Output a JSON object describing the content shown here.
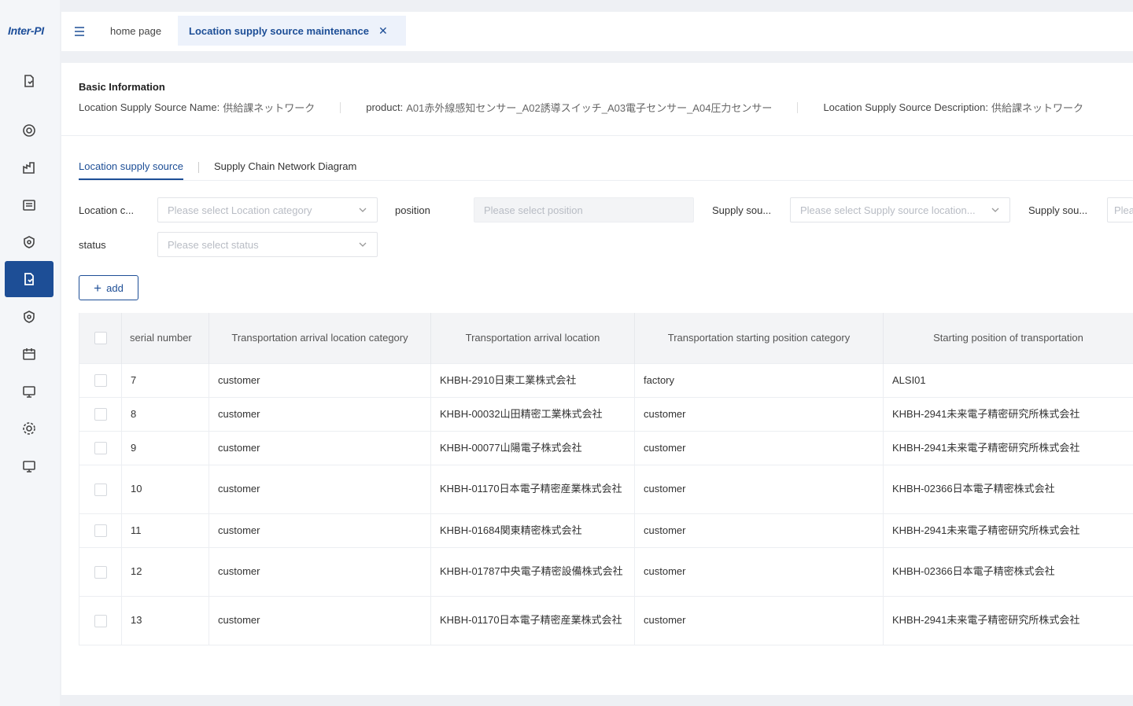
{
  "app": {
    "logo": "Inter-PI"
  },
  "sidebar": {
    "items": [
      {
        "icon": "document-icon",
        "active": false
      },
      {
        "icon": "target-icon",
        "active": false
      },
      {
        "icon": "factory-icon",
        "active": false
      },
      {
        "icon": "list-icon",
        "active": false
      },
      {
        "icon": "shield-icon",
        "active": false
      },
      {
        "icon": "document-icon",
        "active": true
      },
      {
        "icon": "shield-icon",
        "active": false
      },
      {
        "icon": "calendar-icon",
        "active": false
      },
      {
        "icon": "monitor-icon",
        "active": false
      },
      {
        "icon": "gear-icon",
        "active": false
      },
      {
        "icon": "monitor-icon",
        "active": false
      }
    ]
  },
  "topbar": {
    "tabs": [
      {
        "label": "home page"
      },
      {
        "label": "Location supply source maintenance",
        "active": true
      }
    ]
  },
  "basic_info": {
    "title": "Basic Information",
    "name_label": "Location Supply Source Name:",
    "name_value": "供給課ネットワーク",
    "product_label": "product:",
    "product_value": "A01赤外線感知センサー_A02誘導スイッチ_A03電子センサー_A04圧力センサー",
    "desc_label": "Location Supply Source Description:",
    "desc_value": "供給課ネットワーク"
  },
  "subtabs": [
    {
      "label": "Location supply source",
      "active": true
    },
    {
      "label": "Supply Chain Network Diagram",
      "active": false
    }
  ],
  "filters": {
    "location_category": {
      "label": "Location c...",
      "placeholder": "Please select Location category"
    },
    "position": {
      "label": "position",
      "placeholder": "Please select position"
    },
    "supply_location": {
      "label": "Supply sou...",
      "placeholder": "Please select Supply source location..."
    },
    "supply_other": {
      "label": "Supply sou...",
      "placeholder": "Plea"
    },
    "status": {
      "label": "status",
      "placeholder": "Please select status"
    }
  },
  "add_button": {
    "label": "add"
  },
  "table": {
    "columns": [
      "serial number",
      "Transportation arrival location category",
      "Transportation arrival location",
      "Transportation starting position category",
      "Starting position of transportation"
    ],
    "rows": [
      [
        "7",
        "customer",
        "KHBH-2910日東工業株式会社",
        "factory",
        "ALSI01"
      ],
      [
        "8",
        "customer",
        "KHBH-00032山田精密工業株式会社",
        "customer",
        "KHBH-2941未来電子精密研究所株式会社"
      ],
      [
        "9",
        "customer",
        "KHBH-00077山陽電子株式会社",
        "customer",
        "KHBH-2941未来電子精密研究所株式会社"
      ],
      [
        "10",
        "customer",
        "KHBH-01170日本電子精密産業株式会社",
        "customer",
        "KHBH-02366日本電子精密株式会社"
      ],
      [
        "11",
        "customer",
        "KHBH-01684関東精密株式会社",
        "customer",
        "KHBH-2941未来電子精密研究所株式会社"
      ],
      [
        "12",
        "customer",
        "KHBH-01787中央電子精密設備株式会社",
        "customer",
        "KHBH-02366日本電子精密株式会社"
      ],
      [
        "13",
        "customer",
        "KHBH-01170日本電子精密産業株式会社",
        "customer",
        "KHBH-2941未来電子精密研究所株式会社"
      ]
    ]
  }
}
